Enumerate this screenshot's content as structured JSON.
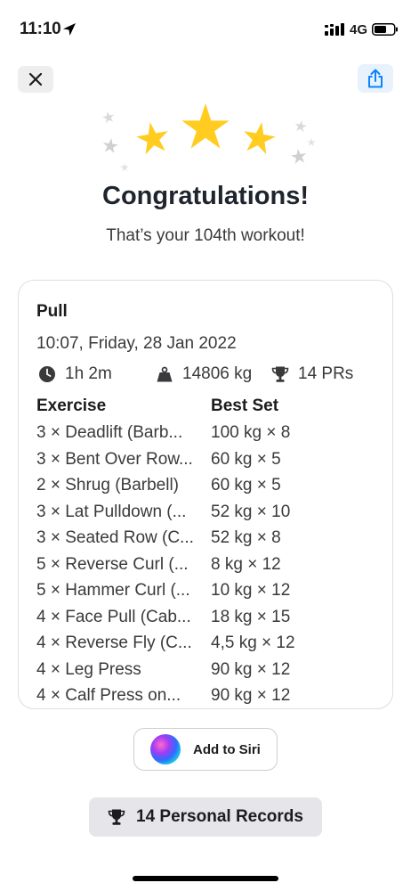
{
  "status_bar": {
    "time": "11:10",
    "network": "4G"
  },
  "header": {
    "close_icon": "close-icon",
    "share_icon": "share-icon"
  },
  "celebration": {
    "title": "Congratulations!",
    "subtitle": "That’s your 104th workout!",
    "star_color": "#ffcc1f"
  },
  "workout": {
    "name": "Pull",
    "date": "10:07, Friday, 28 Jan 2022",
    "duration": "1h 2m",
    "volume": "14806 kg",
    "prs": "14 PRs",
    "columns": {
      "exercise": "Exercise",
      "best_set": "Best Set"
    },
    "exercises": [
      {
        "exercise": "3 × Deadlift (Barb...",
        "best_set": "100 kg × 8"
      },
      {
        "exercise": "3 × Bent Over Row...",
        "best_set": "60 kg × 5"
      },
      {
        "exercise": "2 × Shrug (Barbell)",
        "best_set": "60 kg × 5"
      },
      {
        "exercise": "3 × Lat Pulldown (...",
        "best_set": "52 kg × 10"
      },
      {
        "exercise": "3 × Seated Row (C...",
        "best_set": "52 kg × 8"
      },
      {
        "exercise": "5 × Reverse Curl (...",
        "best_set": "8 kg × 12"
      },
      {
        "exercise": "5 × Hammer Curl (...",
        "best_set": "10 kg × 12"
      },
      {
        "exercise": "4 × Face Pull (Cab...",
        "best_set": "18 kg × 15"
      },
      {
        "exercise": "4 × Reverse Fly (C...",
        "best_set": "4,5 kg × 12"
      },
      {
        "exercise": "4 × Leg Press",
        "best_set": "90 kg × 12"
      },
      {
        "exercise": "4 × Calf Press on...",
        "best_set": "90 kg × 12"
      }
    ]
  },
  "actions": {
    "siri_label": "Add to Siri",
    "records_label": "14 Personal Records"
  },
  "colors": {
    "accent": "#0a84ff",
    "text": "#1c1c1e"
  }
}
